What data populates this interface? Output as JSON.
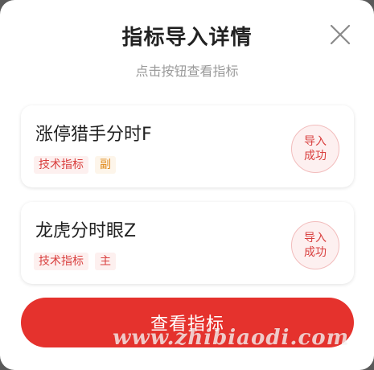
{
  "modal": {
    "title": "指标导入详情",
    "subtitle": "点击按钮查看指标",
    "close_icon": "close-icon"
  },
  "indicators": [
    {
      "name": "涨停猎手分时F",
      "tags": [
        "技术指标",
        "副"
      ],
      "status_line1": "导入",
      "status_line2": "成功"
    },
    {
      "name": "龙虎分时眼Z",
      "tags": [
        "技术指标",
        "主"
      ],
      "status_line1": "导入",
      "status_line2": "成功"
    }
  ],
  "cta": {
    "label": "查看指标"
  },
  "watermark": "www.zhibiaodi.com",
  "colors": {
    "accent": "#e5322d",
    "tag_red": "#d9403f",
    "tag_orange": "#e08a1c"
  }
}
